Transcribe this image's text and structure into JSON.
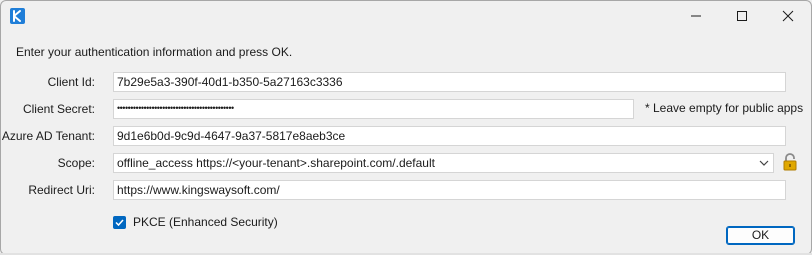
{
  "window": {
    "icon": "kingswaysoft-logo-icon",
    "controls": [
      "minimize-icon",
      "maximize-icon",
      "close-icon"
    ]
  },
  "instruction": "Enter your authentication information and press OK.",
  "fields": {
    "client_id": {
      "label": "Client Id:",
      "value": "7b29e5a3-390f-40d1-b350-5a27163c3336"
    },
    "client_secret": {
      "label": "Client Secret:",
      "value": "••••••••••••••••••••••••••••••••••••••••••••",
      "note": "* Leave empty for public apps"
    },
    "tenant": {
      "label": "Azure AD Tenant:",
      "value": "9d1e6b0d-9c9d-4647-9a37-5817e8aeb3ce"
    },
    "scope": {
      "label": "Scope:",
      "value": "offline_access https://<your-tenant>.sharepoint.com/.default"
    },
    "redirect_uri": {
      "label": "Redirect Uri:",
      "value": "https://www.kingswaysoft.com/"
    }
  },
  "pkce": {
    "label": "PKCE (Enhanced Security)",
    "checked": true
  },
  "ok_button": "OK",
  "colors": {
    "accent": "#0067c0",
    "lock": "#d9a400"
  }
}
